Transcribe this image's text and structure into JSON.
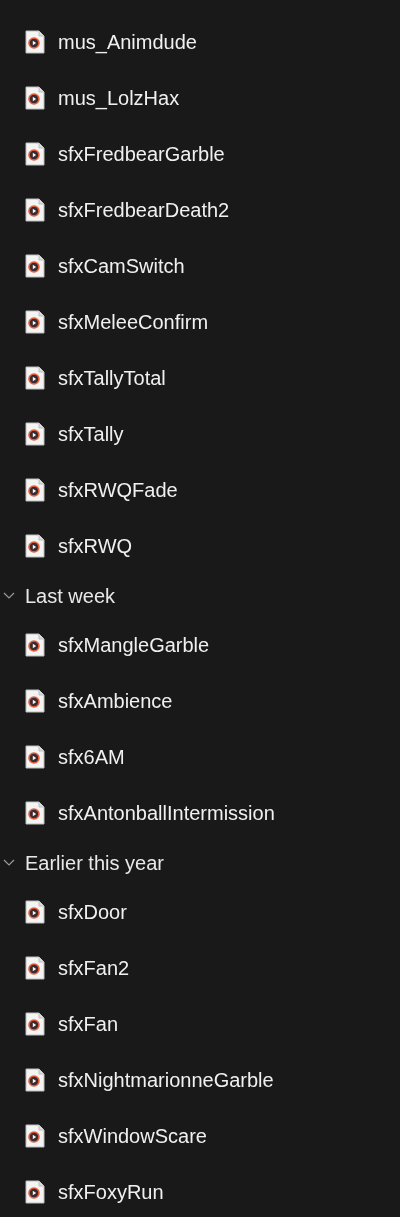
{
  "groups": [
    {
      "items": [
        "mus_Animdude",
        "mus_LolzHax",
        "sfxFredbearGarble",
        "sfxFredbearDeath2",
        "sfxCamSwitch",
        "sfxMeleeConfirm",
        "sfxTallyTotal",
        "sfxTally",
        "sfxRWQFade",
        "sfxRWQ"
      ]
    },
    {
      "label": "Last week",
      "expanded": true,
      "items": [
        "sfxMangleGarble",
        "sfxAmbience",
        "sfx6AM",
        "sfxAntonballIntermission"
      ]
    },
    {
      "label": "Earlier this year",
      "expanded": true,
      "items": [
        "sfxDoor",
        "sfxFan2",
        "sfxFan",
        "sfxNightmarionneGarble",
        "sfxWindowScare",
        "sfxFoxyRun"
      ]
    }
  ]
}
